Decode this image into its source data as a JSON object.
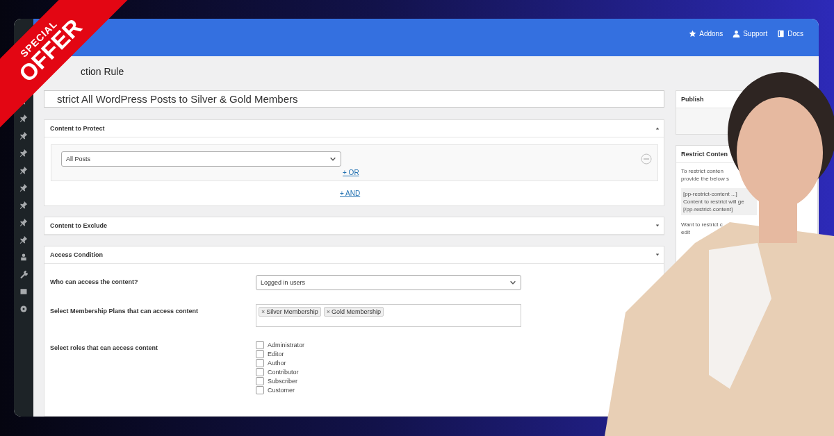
{
  "ribbon": {
    "line_1": "SPECIAL",
    "line_2": "OFFER"
  },
  "top_bar": {
    "links": [
      {
        "kind": "star",
        "label": "Addons"
      },
      {
        "kind": "person",
        "label": "Support"
      },
      {
        "kind": "book",
        "label": "Docs"
      }
    ]
  },
  "heading": "ction Rule",
  "title_field": {
    "value": "strict All WordPress Posts to Silver & Gold Members"
  },
  "panels": [
    {
      "kind": "rules",
      "title": "Content to Protect",
      "expanded": true,
      "select": {
        "value": "All Posts"
      },
      "or_link": "+ OR",
      "and_link": "+ AND"
    },
    {
      "kind": "closed",
      "title": "Content to Exclude",
      "expanded": false
    },
    {
      "kind": "fields",
      "title": "Access Condition",
      "expanded": false,
      "rows": [
        {
          "kind": "select",
          "label": "Who can access the content?",
          "value": "Logged in users"
        },
        {
          "kind": "tags",
          "label": "Select Membership Plans that can access content",
          "tags": [
            {
              "remove": "×",
              "label": "Silver Membership"
            },
            {
              "remove": "×",
              "label": "Gold Membership"
            }
          ]
        },
        {
          "kind": "checkboxes",
          "label": "Select roles that can access content",
          "options": [
            {
              "label": "Administrator",
              "checked": false
            },
            {
              "label": "Editor",
              "checked": false
            },
            {
              "label": "Author",
              "checked": false
            },
            {
              "label": "Contributor",
              "checked": false
            },
            {
              "label": "Subscriber",
              "checked": false
            },
            {
              "label": "Customer",
              "checked": false
            }
          ]
        }
      ]
    }
  ],
  "side_boxes": [
    {
      "title": "Publish"
    },
    {
      "title": "Restrict Conten",
      "blocks": [
        {
          "kind": "text",
          "lines": [
            "To restrict conten",
            "provide the below s"
          ]
        },
        {
          "kind": "code",
          "lines": [
            "[pp-restrict-content ...]",
            "Content to restrict will ge",
            "[/pp-restrict-content]"
          ]
        },
        {
          "kind": "text",
          "lines": [
            "Want to restrict c",
            "edit"
          ]
        }
      ]
    }
  ]
}
